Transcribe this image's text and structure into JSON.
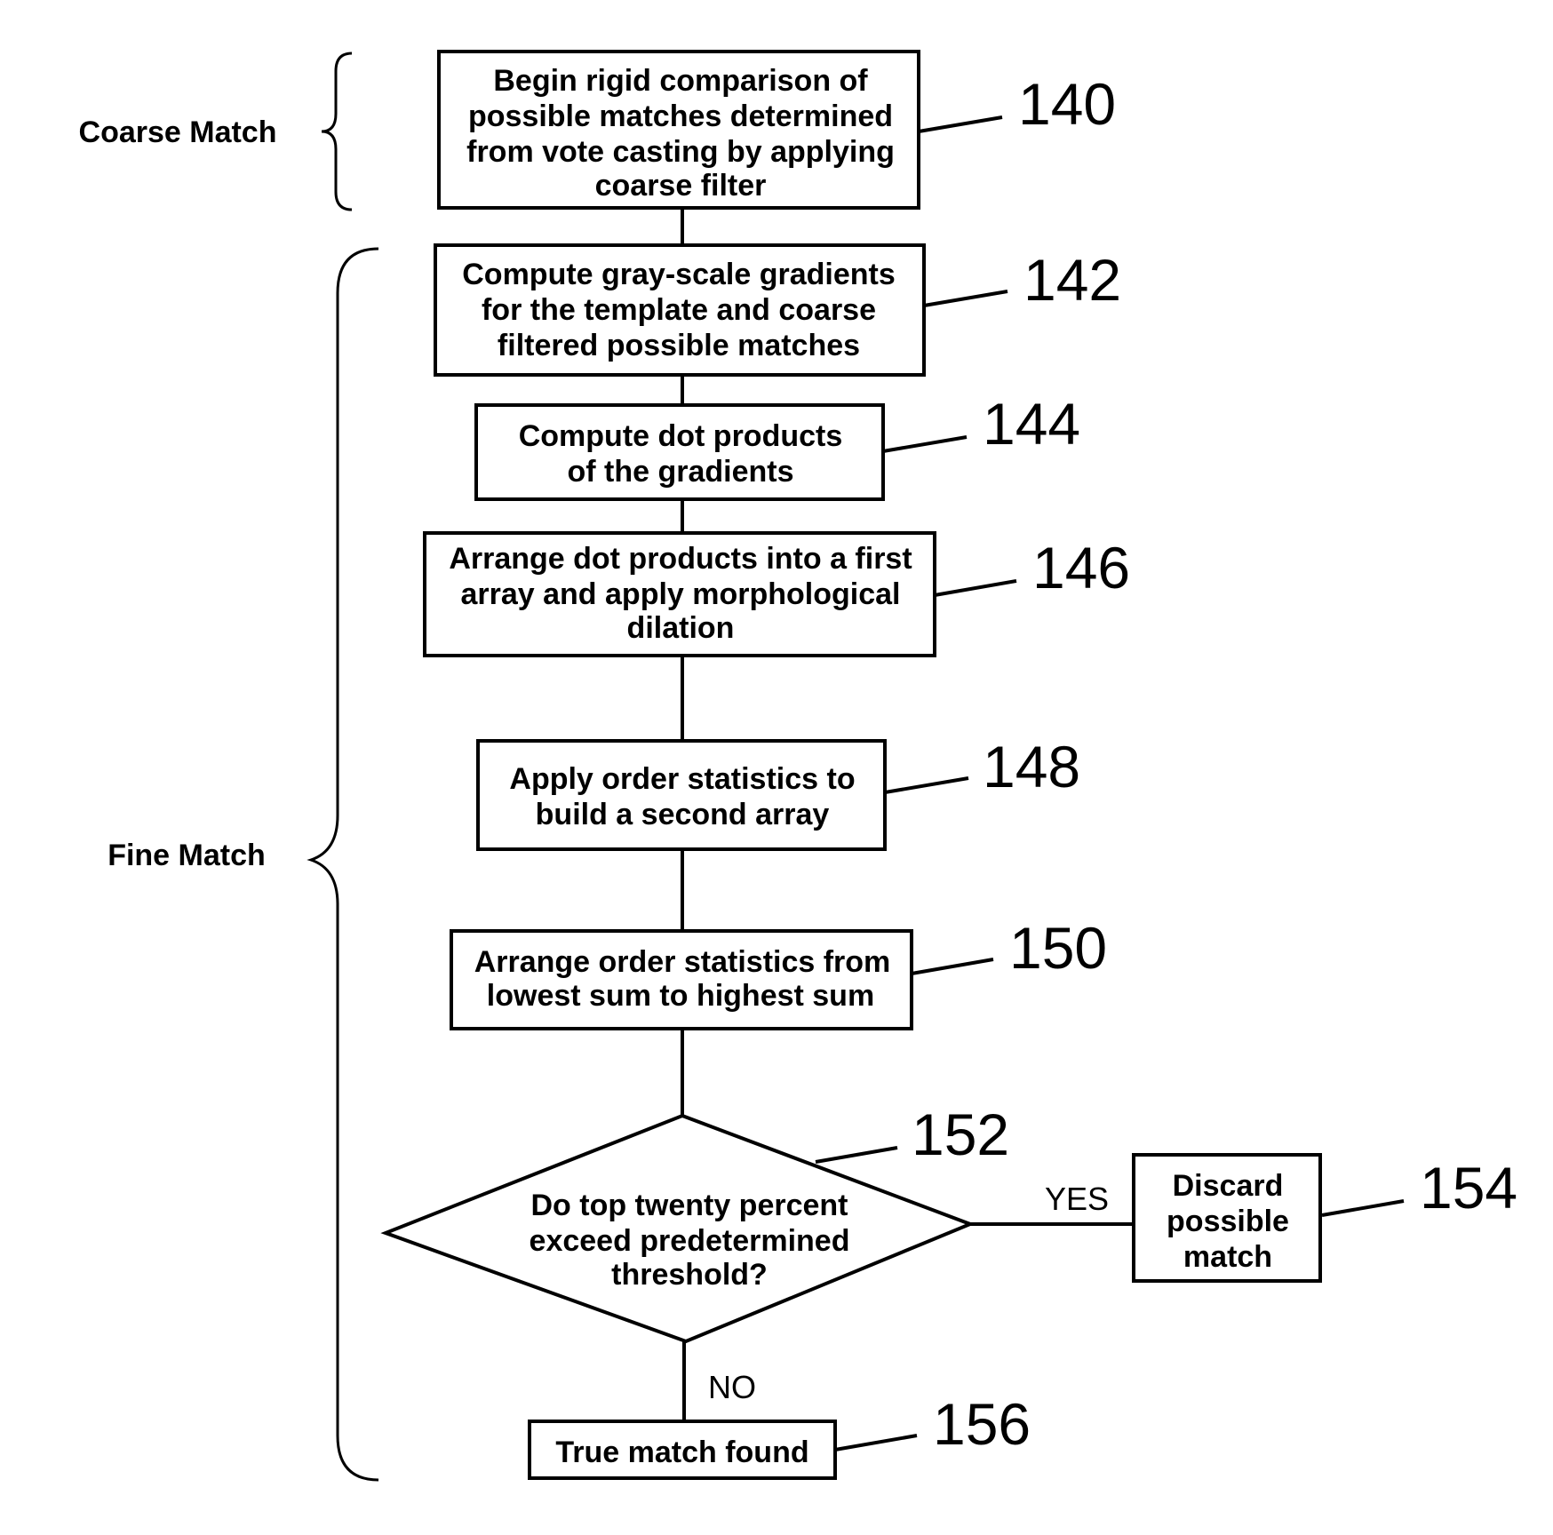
{
  "diagram": {
    "type": "flowchart",
    "phases": [
      {
        "id": "coarse",
        "label": "Coarse Match"
      },
      {
        "id": "fine",
        "label": "Fine Match"
      }
    ],
    "steps": [
      {
        "ref": "140",
        "lines": [
          "Begin rigid comparison of",
          "possible matches determined",
          "from vote casting by applying",
          "coarse filter"
        ]
      },
      {
        "ref": "142",
        "lines": [
          "Compute gray-scale gradients",
          "for the template and coarse",
          "filtered possible matches"
        ]
      },
      {
        "ref": "144",
        "lines": [
          "Compute dot products",
          "of the gradients"
        ]
      },
      {
        "ref": "146",
        "lines": [
          "Arrange dot products into a first",
          "array and apply morphological",
          "dilation"
        ]
      },
      {
        "ref": "148",
        "lines": [
          "Apply order statistics to",
          "build a second array"
        ]
      },
      {
        "ref": "150",
        "lines": [
          "Arrange order statistics from",
          "lowest sum to highest sum"
        ]
      }
    ],
    "decision": {
      "ref": "152",
      "lines": [
        "Do top twenty percent",
        "exceed predetermined",
        "threshold?"
      ],
      "yes_label": "YES",
      "no_label": "NO"
    },
    "yes_outcome": {
      "ref": "154",
      "lines": [
        "Discard",
        "possible",
        "match"
      ]
    },
    "no_outcome": {
      "ref": "156",
      "lines": [
        "True match found"
      ]
    }
  }
}
